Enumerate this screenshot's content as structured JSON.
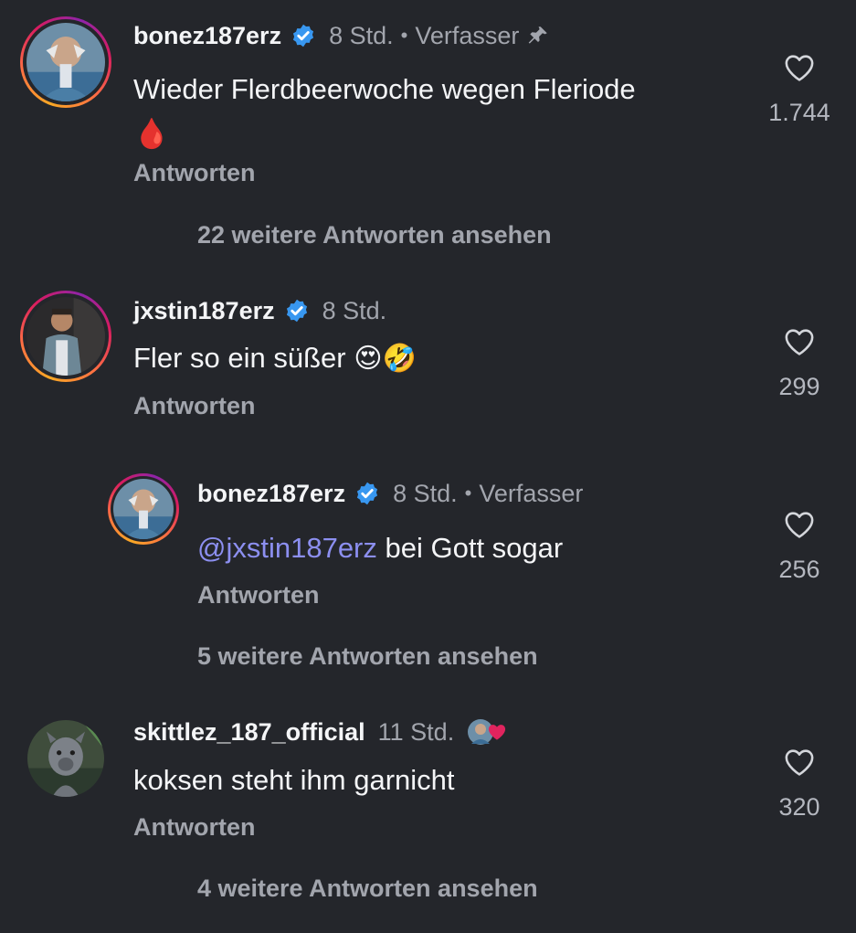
{
  "comments": [
    {
      "username": "bonez187erz",
      "time": "8 Std.",
      "separator": "•",
      "author_label": "Verfasser",
      "text": "Wieder Flerdbeerwoche wegen Fleriode",
      "emoji": "🩸",
      "reply_label": "Antworten",
      "likes": "1.744",
      "more_replies": "22 weitere Antworten ansehen",
      "verified": true,
      "pinned": true
    },
    {
      "username": "jxstin187erz",
      "time": "8 Std.",
      "text": "Fler so ein süßer",
      "emoji": "😍🤣",
      "reply_label": "Antworten",
      "likes": "299",
      "verified": true
    },
    {
      "username": "bonez187erz",
      "time": "8 Std.",
      "separator": "•",
      "author_label": "Verfasser",
      "mention": "@jxstin187erz",
      "text": " bei Gott sogar",
      "reply_label": "Antworten",
      "likes": "256",
      "more_replies": "5 weitere Antworten ansehen",
      "verified": true,
      "is_reply": true
    },
    {
      "username": "skittlez_187_official",
      "time": "11 Std.",
      "text": "koksen steht ihm garnicht",
      "reply_label": "Antworten",
      "likes": "320",
      "more_replies": "4 weitere Antworten ansehen",
      "liked_by_author": true
    }
  ],
  "colors": {
    "background": "#24262b",
    "verified_badge": "#3897f0",
    "mention": "#8c8ff0",
    "secondary_text": "#a2a5ad",
    "heart_red": "#e0245e"
  },
  "icons": {
    "like": "heart-outline-icon",
    "verified": "verified-badge-icon",
    "pinned": "pin-icon",
    "author_liked": "author-heart-icon"
  }
}
